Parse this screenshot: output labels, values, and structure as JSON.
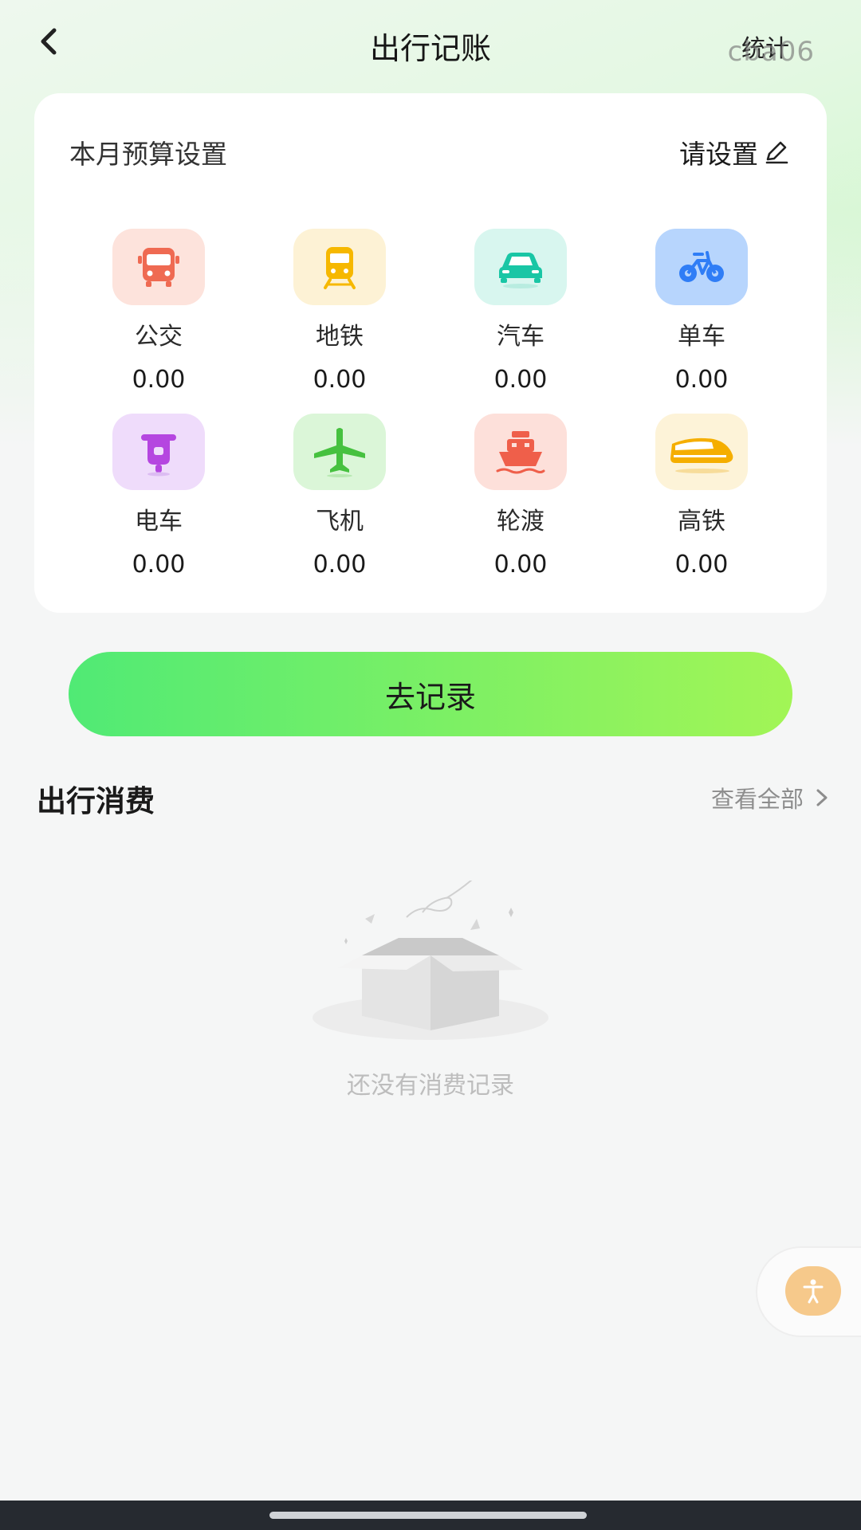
{
  "header": {
    "title": "出行记账",
    "stats_label": "统计",
    "watermark": "cba06"
  },
  "budget_card": {
    "title": "本月预算设置",
    "set_label": "请设置",
    "categories": [
      {
        "label": "公交",
        "value": "0.00",
        "icon": "bus-icon",
        "color": "#ef6a52",
        "bg": "#fde3dc"
      },
      {
        "label": "地铁",
        "value": "0.00",
        "icon": "subway-icon",
        "color": "#f6b800",
        "bg": "#fdf2d5"
      },
      {
        "label": "汽车",
        "value": "0.00",
        "icon": "car-icon",
        "color": "#19c6a5",
        "bg": "#d8f6ef"
      },
      {
        "label": "单车",
        "value": "0.00",
        "icon": "bicycle-icon",
        "color": "#2f7df6",
        "bg": "#b7d5fd"
      },
      {
        "label": "电车",
        "value": "0.00",
        "icon": "scooter-icon",
        "color": "#b546e0",
        "bg": "#efdcfb"
      },
      {
        "label": "飞机",
        "value": "0.00",
        "icon": "airplane-icon",
        "color": "#46c13f",
        "bg": "#dbf6d8"
      },
      {
        "label": "轮渡",
        "value": "0.00",
        "icon": "ship-icon",
        "color": "#ef5f4a",
        "bg": "#fde0da"
      },
      {
        "label": "高铁",
        "value": "0.00",
        "icon": "high-speed-train-icon",
        "color": "#f5ae00",
        "bg": "#fdf3d8"
      }
    ]
  },
  "record_button": {
    "label": "去记录"
  },
  "expenses": {
    "title": "出行消费",
    "view_all": "查看全部",
    "empty_text": "还没有消费记录"
  }
}
